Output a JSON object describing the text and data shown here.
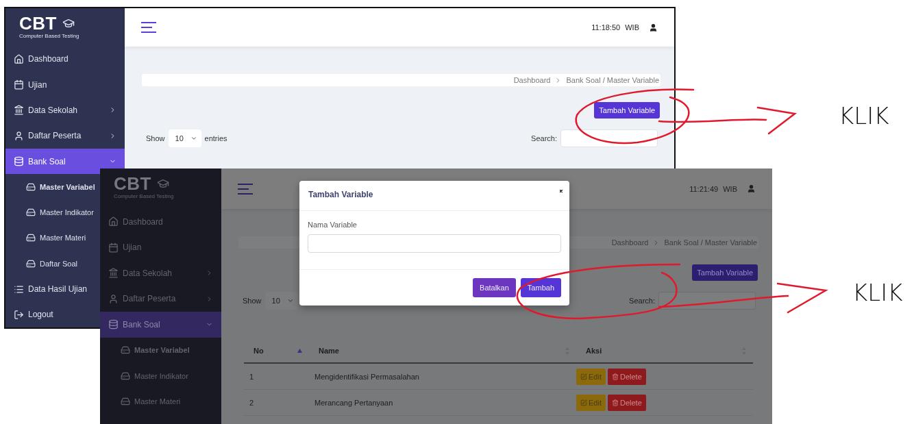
{
  "shots": [
    {
      "logo": {
        "title": "CBT",
        "subtitle": "Computer Based Testing"
      },
      "clock": "11:18:50 WIB",
      "sidebar": [
        {
          "label": "Dashboard",
          "selected": false
        },
        {
          "label": "Ujian",
          "selected": false
        },
        {
          "label": "Data Sekolah",
          "selected": false,
          "expanded": false
        },
        {
          "label": "Daftar Peserta",
          "selected": false,
          "expanded": false
        },
        {
          "label": "Bank Soal",
          "selected": true,
          "expanded": true,
          "children": [
            {
              "label": "Master Variabel",
              "selected": true
            },
            {
              "label": "Master Indikator",
              "selected": false
            },
            {
              "label": "Master Materi",
              "selected": false
            },
            {
              "label": "Daftar Soal",
              "selected": false
            }
          ]
        },
        {
          "label": "Data Hasil Ujian",
          "selected": false
        },
        {
          "label": "Logout",
          "selected": false
        }
      ],
      "breadcrumb": [
        "Dashboard",
        "Bank Soal / Master Variable"
      ],
      "add_button": "Tambah Variable",
      "length": {
        "show": "Show",
        "value": "10",
        "suffix": "entries"
      },
      "search": {
        "label": "Search:"
      }
    },
    {
      "logo": {
        "title": "CBT",
        "subtitle": "Computer Based Testing"
      },
      "clock": "11:21:49 WIB",
      "sidebar": [
        {
          "label": "Dashboard",
          "selected": false
        },
        {
          "label": "Ujian",
          "selected": false
        },
        {
          "label": "Data Sekolah",
          "selected": false,
          "expanded": false
        },
        {
          "label": "Daftar Peserta",
          "selected": false,
          "expanded": false
        },
        {
          "label": "Bank Soal",
          "selected": true,
          "expanded": true,
          "children": [
            {
              "label": "Master Variabel",
              "selected": true
            },
            {
              "label": "Master Indikator",
              "selected": false
            },
            {
              "label": "Master Materi",
              "selected": false
            }
          ]
        }
      ],
      "breadcrumb": [
        "Dashboard",
        "Bank Soal / Master Variable"
      ],
      "add_button": "Tambah Variable",
      "length": {
        "show": "Show",
        "value": "10"
      },
      "search": {
        "label": "Search:"
      },
      "table": {
        "columns": [
          {
            "label": "No",
            "sorted": true
          },
          {
            "label": "Name",
            "sorted": false
          },
          {
            "label": "Aksi",
            "sorted": false
          }
        ],
        "rows": [
          {
            "cells": [
              "1",
              "Mengidentifikasi Permasalahan"
            ],
            "actions": [
              {
                "kind": "edit",
                "label": "Edit"
              },
              {
                "kind": "delete",
                "label": "Delete"
              }
            ]
          },
          {
            "cells": [
              "2",
              "Merancang Pertanyaan"
            ],
            "actions": [
              {
                "kind": "edit",
                "label": "Edit"
              },
              {
                "kind": "delete",
                "label": "Delete"
              }
            ]
          }
        ]
      },
      "modal": {
        "title": "Tambah Variable",
        "field_label": "Nama Variable",
        "buttons": [
          {
            "kind": "cancel",
            "label": "Batalkan"
          },
          {
            "kind": "submit",
            "label": "Tambah"
          }
        ]
      }
    }
  ],
  "annotations": [
    {
      "label": "KLIK"
    },
    {
      "label": "KLIK"
    }
  ]
}
